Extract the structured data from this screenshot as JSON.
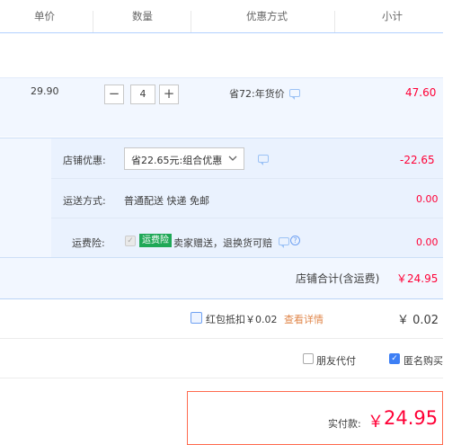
{
  "header": {
    "price": "单价",
    "quantity": "数量",
    "discount": "优惠方式",
    "subtotal": "小计"
  },
  "item": {
    "price": "29.90",
    "quantity": "4",
    "promo": "省72:年货价",
    "subtotal": "47.60"
  },
  "shop": {
    "coupon_label": "店铺优惠:",
    "coupon_value": "省22.65元:组合优惠",
    "coupon_amount": "-22.65",
    "shipping_label": "运送方式:",
    "shipping_value": "普通配送 快递 免邮",
    "shipping_amount": "0.00",
    "insurance_label": "运费险:",
    "insurance_tag": "运费险",
    "insurance_text": "卖家赠送，退换货可赔",
    "insurance_amount": "0.00",
    "total_label": "店铺合计(含运费)",
    "total_value": "￥24.95"
  },
  "redpacket": {
    "label": "红包抵扣￥0.02",
    "link": "查看详情",
    "amount": "￥ 0.02"
  },
  "options": {
    "friend_pay": "朋友代付",
    "anonymous": "匿名购买"
  },
  "payment": {
    "label": "实付款:",
    "currency": "￥",
    "amount": "24.95"
  },
  "colors": {
    "accent_red": "#ff0036",
    "link_blue": "#3d7ff5",
    "green_tag": "#1fa857"
  },
  "icons": [
    "minus-icon",
    "plus-icon",
    "chat-icon",
    "chevron-down-icon",
    "check-icon",
    "help-icon"
  ]
}
